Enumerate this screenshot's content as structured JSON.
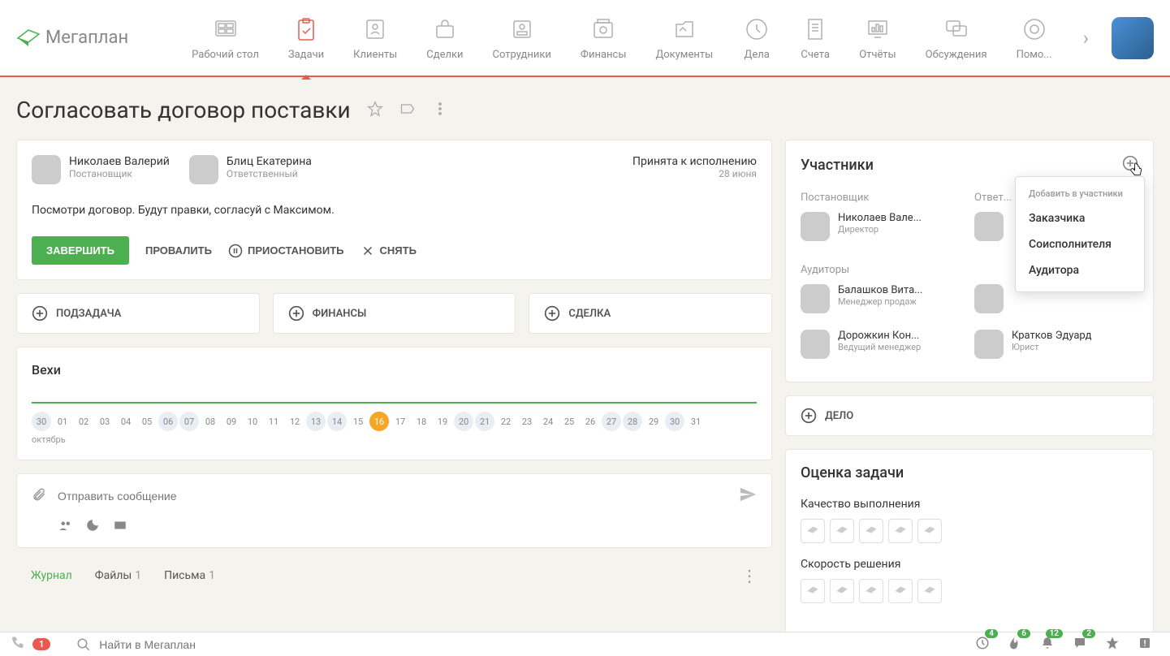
{
  "logo": "Мегаплан",
  "nav": [
    {
      "label": "Рабочий стол"
    },
    {
      "label": "Задачи"
    },
    {
      "label": "Клиенты"
    },
    {
      "label": "Сделки"
    },
    {
      "label": "Сотрудники"
    },
    {
      "label": "Финансы"
    },
    {
      "label": "Документы"
    },
    {
      "label": "Дела"
    },
    {
      "label": "Счета"
    },
    {
      "label": "Отчёты"
    },
    {
      "label": "Обсуждения"
    },
    {
      "label": "Помо..."
    }
  ],
  "page_title": "Согласовать договор поставки",
  "task": {
    "creator": {
      "name": "Николаев Валерий",
      "role": "Постановщик"
    },
    "assignee": {
      "name": "Блиц Екатерина",
      "role": "Ответственный"
    },
    "status": "Принята к исполнению",
    "status_date": "28 июня",
    "description": "Посмотри договор. Будут правки, согласуй с Максимом."
  },
  "actions": {
    "complete": "ЗАВЕРШИТЬ",
    "fail": "ПРОВАЛИТЬ",
    "pause": "ПРИОСТАНОВИТЬ",
    "remove": "СНЯТЬ"
  },
  "add_buttons": {
    "subtask": "ПОДЗАДАЧА",
    "finance": "ФИНАНСЫ",
    "deal": "СДЕЛКА"
  },
  "milestones": {
    "title": "Вехи",
    "month": "октябрь",
    "days": [
      "30",
      "01",
      "02",
      "03",
      "04",
      "05",
      "06",
      "07",
      "08",
      "09",
      "10",
      "11",
      "12",
      "13",
      "14",
      "15",
      "16",
      "17",
      "18",
      "19",
      "20",
      "21",
      "22",
      "23",
      "24",
      "25",
      "26",
      "27",
      "28",
      "29",
      "30",
      "31"
    ],
    "dim_days": [
      "30",
      "06",
      "07",
      "13",
      "14",
      "20",
      "21",
      "27",
      "28"
    ],
    "active_day": "16"
  },
  "comment": {
    "placeholder": "Отправить сообщение"
  },
  "tabs": {
    "journal": "Журнал",
    "files": "Файлы",
    "files_count": "1",
    "letters": "Письма",
    "letters_count": "1"
  },
  "participants": {
    "title": "Участники",
    "dropdown_label": "Добавить в участники",
    "dropdown_items": [
      "Заказчика",
      "Соисполнителя",
      "Аудитора"
    ],
    "sections": {
      "creator_label": "Постановщик",
      "creator": {
        "name": "Николаев Вале...",
        "role": "Директор"
      },
      "assignee_label": "Ответ...",
      "auditors_label": "Аудиторы",
      "auditors": [
        {
          "name": "Балашков Вита...",
          "role": "Менеджер продаж"
        },
        {
          "name": "",
          "role": ""
        },
        {
          "name": "Дорожкин Кон...",
          "role": "Ведущий менеджер"
        },
        {
          "name": "Кратков Эдуард",
          "role": "Юрист"
        }
      ]
    }
  },
  "delo_btn": "ДЕЛО",
  "rating": {
    "title": "Оценка задачи",
    "quality": "Качество выполнения",
    "speed": "Скорость решения"
  },
  "bottombar": {
    "call_badge": "1",
    "search_placeholder": "Найти в Мегаплан",
    "counts": {
      "clock": "4",
      "fire": "6",
      "bell": "12",
      "chat": "2"
    }
  }
}
